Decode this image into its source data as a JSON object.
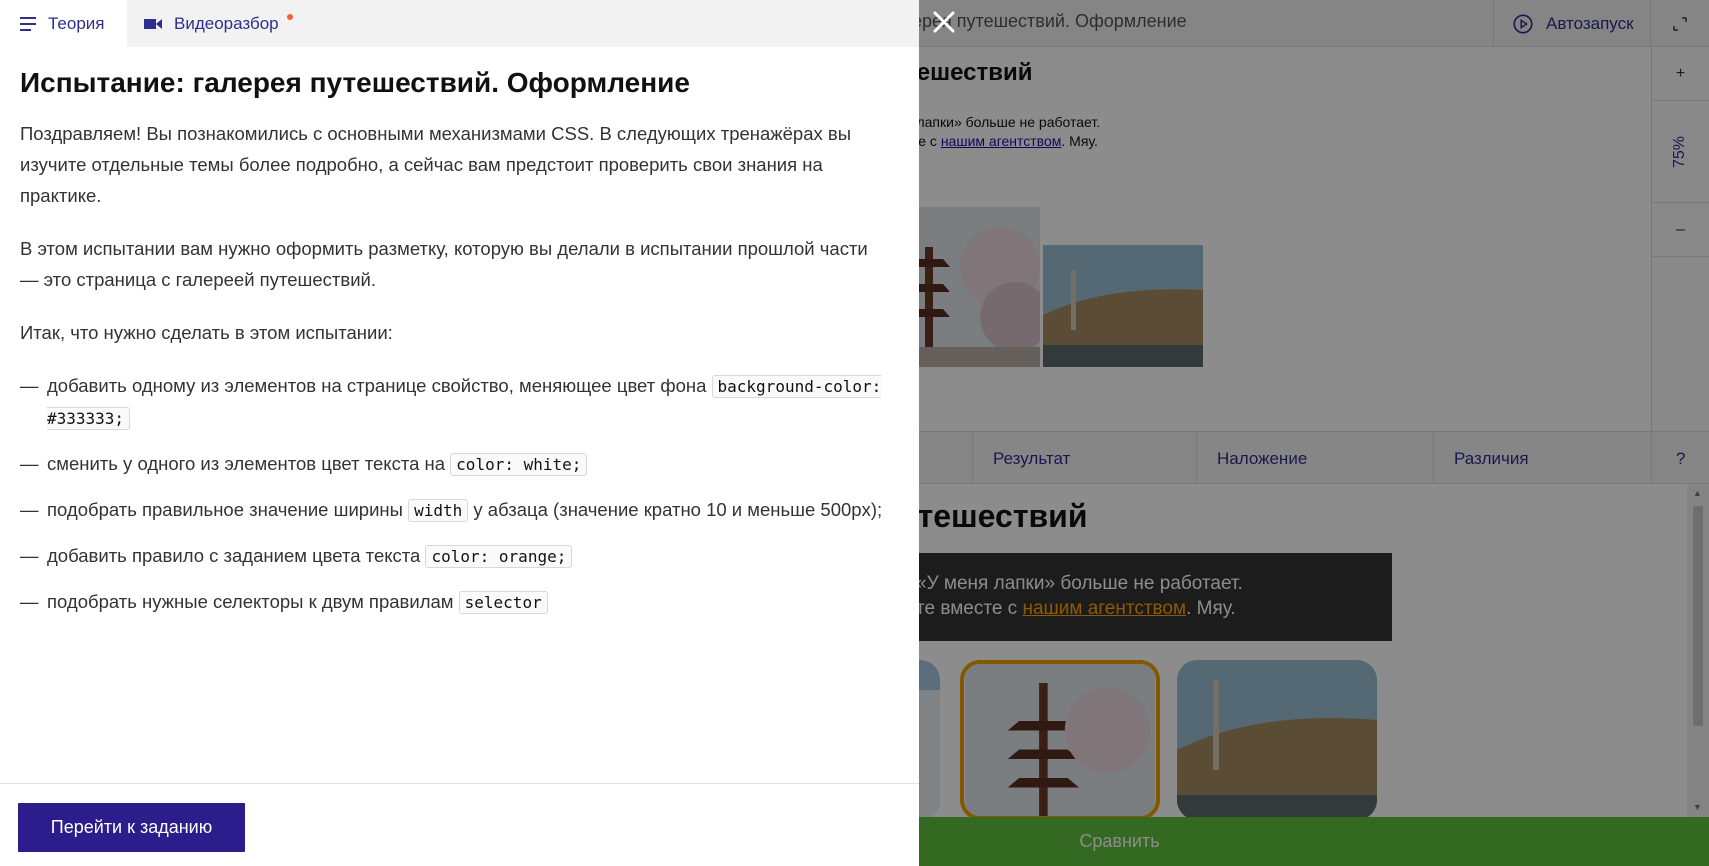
{
  "panel": {
    "tabs": [
      {
        "label": "Теория",
        "icon": "menu-icon",
        "active": true
      },
      {
        "label": "Видеоразбор",
        "icon": "video-camera-icon",
        "has_notification_dot": true
      }
    ],
    "title": "Испытание: галерея путешествий. Оформление",
    "paragraphs": [
      "Поздравляем! Вы познакомились с основными механизмами CSS. В следующих тренажёрах вы изучите отдельные темы более подробно, а сейчас вам предстоит проверить свои знания на практике.",
      "В этом испытании вам нужно оформить разметку, которую вы делали в испытании прошлой части — это страница с галереей путешествий.",
      "Итак, что нужно сделать в этом испытании:"
    ],
    "tasks": [
      {
        "text": "добавить одному из элементов на странице свойство, меняющее цвет фона",
        "code": "background-color: #333333;",
        "after": ""
      },
      {
        "text": "сменить у одного из элементов цвет текста на",
        "code": "color: white;",
        "after": ""
      },
      {
        "text": "подобрать правильное значение ширины",
        "code": "width",
        "after": "у абзаца (значение кратно 10 и меньше 500px);"
      },
      {
        "text": "добавить правило с заданием цвета текста",
        "code": "color: orange;",
        "after": ""
      },
      {
        "text": "подобрать нужные селекторы к двум правилам",
        "code": "selector",
        "after": ""
      }
    ],
    "primary_button": "Перейти к заданию",
    "close_icon": "close-icon"
  },
  "workspace": {
    "title_fragment": "ерея путешествий. Оформление",
    "autorun_label": "Автозапуск",
    "zoom": {
      "plus": "+",
      "level": "75%",
      "minus": "–"
    },
    "preview": {
      "heading_fragment": "тешествий",
      "text_line1": "я лапки» больше не работает.",
      "text_line2_before": "сте с ",
      "text_line2_link": "нашим агентством",
      "text_line2_after": ". Мяу."
    },
    "view_tabs": [
      "Результат",
      "Наложение",
      "Различия",
      "?"
    ],
    "result": {
      "heading_fragment": "путешествий",
      "text_line1": "«У меня лапки» больше не работает.",
      "text_line2_before": "те вместе с ",
      "text_line2_link": "нашим агентством",
      "text_line2_after": ". Мяу."
    },
    "compare_button": "Сравнить",
    "colors": {
      "dark_block": "#333333",
      "link_orange": "#ffa500",
      "compare_green": "#5fbf3f",
      "primary_purple": "#2b1d8c"
    }
  }
}
